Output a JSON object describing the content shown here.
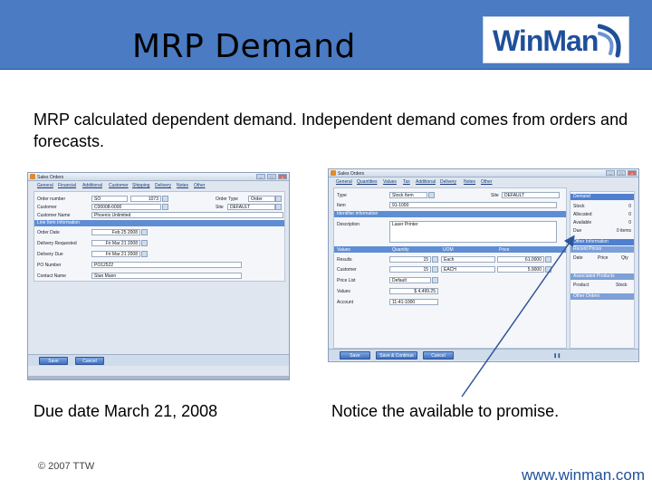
{
  "slide": {
    "title": "MRP Demand",
    "logo_text": "WinMan",
    "subtitle": "MRP calculated dependent demand.  Independent demand comes from orders and forecasts.",
    "caption_left": "Due date March 21, 2008",
    "caption_right": "Notice the available to promise.",
    "copyright": "© 2007 TTW",
    "website": "www.winman.com",
    "colors": {
      "header": "#4a7bc3",
      "accent": "#1f4f9a",
      "section": "#5f8dd3",
      "arrow": "#2f5597"
    }
  },
  "sales_order_window": {
    "title": "Sales Orders",
    "tabs": [
      "General",
      "Financial",
      "Additional",
      "Customer",
      "Shipping",
      "Delivery",
      "Notes",
      "Other"
    ],
    "fields": {
      "order_number_label": "Order number",
      "order_number_prefix": "SO",
      "order_number_value": "1073",
      "order_type_label": "Order Type",
      "order_type_value": "Order",
      "customer_label": "Customer",
      "customer_value": "C00008-0000",
      "site_label": "Site",
      "site_value": "DEFAULT",
      "customer_name_label": "Customer Name",
      "customer_name_value": "Phoenix Unlimited",
      "section": "Line Item Information",
      "order_date_label": "Order Date",
      "order_date_value": "Feb 25 2008",
      "delivery_requested_label": "Delivery Requested",
      "delivery_requested_value": "Fri Mar 21 2008",
      "delivery_due_label": "Delivery Due",
      "delivery_due_value": "Fri Mar 21 2008",
      "po_number_label": "PO Number",
      "po_number_value": "PO12522",
      "contact_name_label": "Contact Name",
      "contact_name_value": "Stan Mann"
    },
    "buttons": {
      "save": "Save",
      "cancel": "Cancel"
    }
  },
  "line_item_window": {
    "title": "Sales Orders",
    "tabs": [
      "General",
      "Quantities",
      "Values",
      "Tax",
      "Additional",
      "Delivery",
      "Notes",
      "Other"
    ],
    "fields": {
      "type_label": "Type",
      "type_value": "Stock Item",
      "site_label": "Site",
      "site_value": "DEFAULT",
      "item_label": "Item",
      "item_value": "91-1000",
      "identifier_section": "Identifier information",
      "description_label": "Description",
      "description_value": "Laser Printer"
    },
    "values_grid": {
      "headers": [
        "Values",
        "Quantity",
        "UOM",
        "Price"
      ],
      "rows": [
        {
          "label": "Results",
          "qty": "15",
          "uom": "Each",
          "price": "61.0000"
        },
        {
          "label": "Customer",
          "qty": "15",
          "uom": "EACH",
          "price": "5.9000"
        }
      ],
      "price_list_label": "Price List",
      "price_list_value": "Default",
      "values_label": "Values",
      "values_value": "$ 4,499.25",
      "account_label": "Account",
      "account_value": "11-41-1000"
    },
    "demand_panel": {
      "header": "Demand",
      "rows": [
        {
          "label": "Stock",
          "value": "0"
        },
        {
          "label": "Allocated",
          "value": "0"
        },
        {
          "label": "Available",
          "value": "0"
        },
        {
          "label": "Due",
          "value": "0 items"
        }
      ],
      "other_header": "Other Information",
      "other_subheader": "Recent Prices",
      "other_columns": [
        "Date",
        "Price",
        "Qty"
      ],
      "related_header": "Associated Products",
      "related_columns": [
        "Product",
        "Stock"
      ],
      "other_orders": "Other Orders"
    },
    "buttons": {
      "save": "Save",
      "save_continue": "Save & Continue",
      "cancel": "Cancel"
    }
  }
}
